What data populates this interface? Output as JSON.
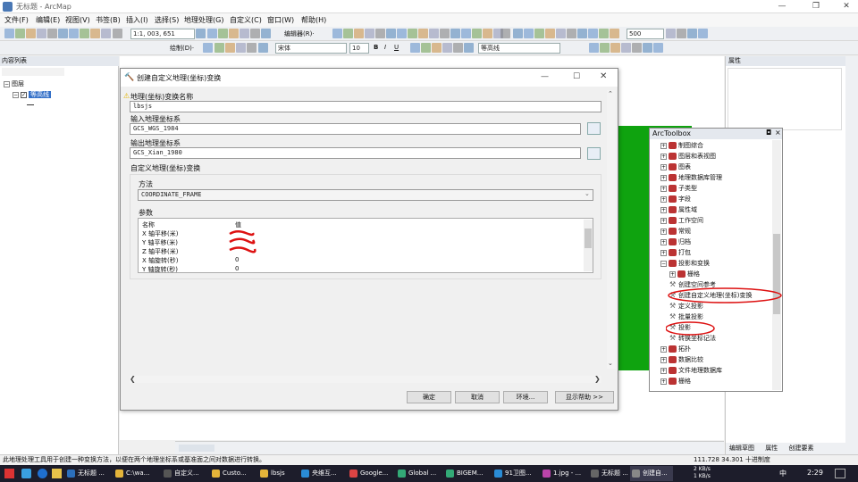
{
  "window": {
    "title": "无标题 - ArcMap"
  },
  "menu": [
    "文件(F)",
    "编辑(E)",
    "视图(V)",
    "书签(B)",
    "插入(I)",
    "选择(S)",
    "地理处理(G)",
    "自定义(C)",
    "窗口(W)",
    "帮助(H)"
  ],
  "toolbar": {
    "scale": "1:1, 003, 651",
    "editor_label": "编辑器(R)·",
    "draw_label": "绘制(D)·",
    "font": "宋体",
    "font_size": "10",
    "layer_select": "等高线",
    "zoom_value": "500"
  },
  "toc": {
    "title": "内容列表",
    "root": "图层",
    "layer": "等高线"
  },
  "props": {
    "title": "属性"
  },
  "dialog": {
    "title": "创建自定义地理(坐标)变换",
    "name_label": "地理(坐标)变换名称",
    "name_value": "lbsjs",
    "input_label": "输入地理坐标系",
    "input_value": "GCS_WGS_1984",
    "output_label": "输出地理坐标系",
    "output_value": "GCS_Xian_1980",
    "custom_label": "自定义地理(坐标)变换",
    "method_label": "方法",
    "method_value": "COORDINATE_FRAME",
    "params_label": "参数",
    "param_headers": [
      "名称",
      "值"
    ],
    "params": [
      {
        "name": "X 轴平移(米)",
        "value": ""
      },
      {
        "name": "Y 轴平移(米)",
        "value": ""
      },
      {
        "name": "Z 轴平移(米)",
        "value": ""
      },
      {
        "name": "X 轴旋转(秒)",
        "value": "0"
      },
      {
        "name": "Y 轴旋转(秒)",
        "value": "0"
      }
    ],
    "buttons": {
      "ok": "确定",
      "cancel": "取消",
      "env": "环境...",
      "help": "显示帮助 >>"
    }
  },
  "toolbox": {
    "title": "ArcToolbox",
    "items": [
      {
        "label": "制图综合",
        "type": "toolbox",
        "indent": 1
      },
      {
        "label": "图层和表视图",
        "type": "toolbox",
        "indent": 1
      },
      {
        "label": "图表",
        "type": "toolbox",
        "indent": 1
      },
      {
        "label": "地理数据库管理",
        "type": "toolbox",
        "indent": 1
      },
      {
        "label": "子类型",
        "type": "toolbox",
        "indent": 1
      },
      {
        "label": "字段",
        "type": "toolbox",
        "indent": 1
      },
      {
        "label": "属性域",
        "type": "toolbox",
        "indent": 1
      },
      {
        "label": "工作空间",
        "type": "toolbox",
        "indent": 1
      },
      {
        "label": "常规",
        "type": "toolbox",
        "indent": 1
      },
      {
        "label": "归档",
        "type": "toolbox",
        "indent": 1
      },
      {
        "label": "打包",
        "type": "toolbox",
        "indent": 1
      },
      {
        "label": "投影和变换",
        "type": "toolbox-open",
        "indent": 1
      },
      {
        "label": "栅格",
        "type": "toolbox",
        "indent": 2
      },
      {
        "label": "创建空间参考",
        "type": "tool",
        "indent": 2
      },
      {
        "label": "创建自定义地理(坐标)变换",
        "type": "tool",
        "indent": 2
      },
      {
        "label": "定义投影",
        "type": "tool",
        "indent": 2
      },
      {
        "label": "批量投影",
        "type": "tool",
        "indent": 2
      },
      {
        "label": "投影",
        "type": "tool",
        "indent": 2
      },
      {
        "label": "转换坐标记法",
        "type": "tool",
        "indent": 2
      },
      {
        "label": "拓扑",
        "type": "toolbox",
        "indent": 1
      },
      {
        "label": "数据比较",
        "type": "toolbox",
        "indent": 1
      },
      {
        "label": "文件地理数据库",
        "type": "toolbox",
        "indent": 1
      },
      {
        "label": "栅格",
        "type": "toolbox",
        "indent": 1
      }
    ]
  },
  "map_footer_tabs": [
    "编辑草图",
    "属性",
    "创建要素"
  ],
  "status": {
    "message": "此地理处理工具用于创建一种变换方法，以便在两个地理坐标系或基准面之间对数据进行转换。",
    "coords": "111.728  34.301 十进制度"
  },
  "taskbar": {
    "items": [
      {
        "label": "无标题 ...",
        "color": "#2c6fbb"
      },
      {
        "label": "C:\\wa...",
        "color": "#e4b43a"
      },
      {
        "label": "自定义...",
        "color": "#555"
      },
      {
        "label": "Custo...",
        "color": "#e4b43a"
      },
      {
        "label": "lbsjs",
        "color": "#e4b43a"
      },
      {
        "label": "央维互...",
        "color": "#2a8cd6"
      },
      {
        "label": "Google...",
        "color": "#d44"
      },
      {
        "label": "Global ...",
        "color": "#3a7"
      },
      {
        "label": "BIGEM...",
        "color": "#3a7"
      },
      {
        "label": "91卫图...",
        "color": "#2a8cd6"
      },
      {
        "label": "1.jpg - ...",
        "color": "#b4a"
      },
      {
        "label": "无标题 ...",
        "color": "#666"
      },
      {
        "label": "创建自...",
        "color": "#888"
      }
    ],
    "net_up": "2 KB/s",
    "net_down": "1 KB/s",
    "ime": "中",
    "time": "2:29"
  }
}
